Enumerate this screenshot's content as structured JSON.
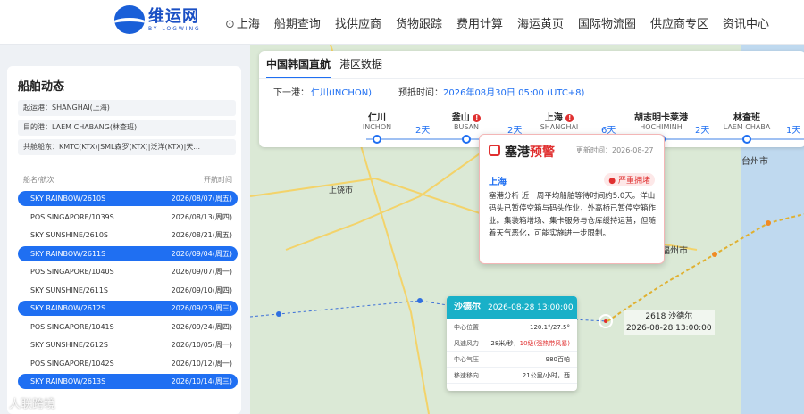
{
  "header": {
    "logo_cn": "维运网",
    "logo_en": "BY LOGWING",
    "location": "上海",
    "nav": [
      "船期查询",
      "找供应商",
      "货物跟踪",
      "费用计算",
      "海运黄页",
      "国际物流圈",
      "供应商专区",
      "资讯中心"
    ]
  },
  "ship_info": {
    "title": "船舶动态",
    "origin": "起运港：SHANGHAI(上海)",
    "destination": "目的港：LAEM CHABANG(林查班)",
    "shared": "共舱船东：KMTC(KTX)|SML森罗(KTX)|泛洋(KTX)|天..."
  },
  "vessel_list": {
    "col_name": "船名/航次",
    "col_date": "开航时间",
    "rows": [
      {
        "name": "SKY RAINBOW/2610S",
        "date": "2026/08/07(周五)",
        "active": true
      },
      {
        "name": "POS SINGAPORE/1039S",
        "date": "2026/08/13(周四)",
        "active": false
      },
      {
        "name": "SKY SUNSHINE/2610S",
        "date": "2026/08/21(周五)",
        "active": false
      },
      {
        "name": "SKY RAINBOW/2611S",
        "date": "2026/09/04(周五)",
        "active": true
      },
      {
        "name": "POS SINGAPORE/1040S",
        "date": "2026/09/07(周一)",
        "active": false
      },
      {
        "name": "SKY SUNSHINE/2611S",
        "date": "2026/09/10(周四)",
        "active": false
      },
      {
        "name": "SKY RAINBOW/2612S",
        "date": "2026/09/23(周三)",
        "active": true
      },
      {
        "name": "POS SINGAPORE/1041S",
        "date": "2026/09/24(周四)",
        "active": false
      },
      {
        "name": "SKY SUNSHINE/2612S",
        "date": "2026/10/05(周一)",
        "active": false
      },
      {
        "name": "POS SINGAPORE/1042S",
        "date": "2026/10/12(周一)",
        "active": false
      },
      {
        "name": "SKY RAINBOW/2613S",
        "date": "2026/10/14(周三)",
        "active": true
      }
    ]
  },
  "route": {
    "tabs": [
      "中国韩国直航",
      "港区数据"
    ],
    "next_port_label": "下一港：",
    "next_port": "仁川(INCHON)",
    "eta_label": "预抵时间：",
    "eta": "2026年08月30日 05:00 (UTC+8)",
    "ports": [
      {
        "name": "仁川",
        "en": "INCHON",
        "warn": false
      },
      {
        "name": "釜山",
        "en": "BUSAN",
        "warn": true
      },
      {
        "name": "上海",
        "en": "SHANGHAI",
        "warn": true
      },
      {
        "name": "胡志明卡莱港",
        "en": "HOCHIMINH",
        "warn": false
      },
      {
        "name": "林查班",
        "en": "LAEM CHABA",
        "warn": false
      }
    ],
    "days": [
      "2天",
      "2天",
      "6天",
      "2天",
      "1天"
    ]
  },
  "alert": {
    "title_a": "塞港",
    "title_b": "预警",
    "updated": "更新时间：2026-08-27",
    "port": "上海",
    "level": "● 严重拥堵",
    "body": "塞港分析 近一周平均船舶等待时间约5.0天。洋山码头已暂停空箱与码头作业，外高桥已暂停空箱作业。集装箱增场、集卡服务与仓库缓持运营，但随着天气恶化，可能实施进一步限制。"
  },
  "typhoon": {
    "name": "沙德尔",
    "time": "2026-08-28 13:00:00",
    "rows": [
      {
        "k": "中心位置",
        "v": "120.1°/27.5°"
      },
      {
        "k": "风速风力",
        "v": "28米/秒，",
        "r": "10级(强热带风暴)"
      },
      {
        "k": "中心气压",
        "v": "980百帕"
      },
      {
        "k": "移速移向",
        "v": "21公里/小时，西"
      }
    ],
    "map_label_name": "2618 沙德尔",
    "map_label_time": "2026-08-28 13:00:00"
  },
  "map_labels": [
    "上饶市",
    "台州市",
    "福州市"
  ],
  "watermark": "人联跨境"
}
